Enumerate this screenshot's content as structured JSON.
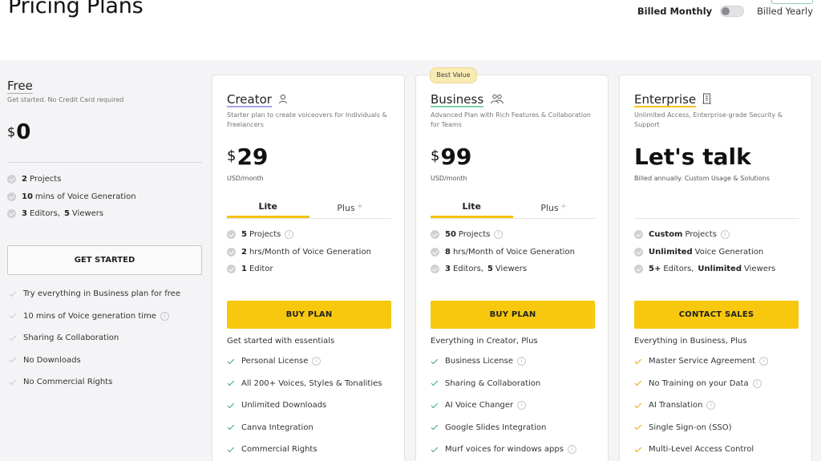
{
  "header": {
    "title": "Pricing Plans",
    "billed_monthly": "Billed Monthly",
    "billed_yearly": "Billed Yearly"
  },
  "free": {
    "name": "Free",
    "desc": "Get started. No Credit Card required",
    "currency": "$",
    "price": "0",
    "core": [
      {
        "bold": "2",
        "text": "Projects"
      },
      {
        "bold": "10",
        "text": "mins of Voice Generation"
      },
      {
        "bold": "3",
        "text": "Editors,",
        "bold2": "5",
        "text2": "Viewers"
      }
    ],
    "button": "GET STARTED",
    "extras": [
      {
        "text": "Try everything in Business plan for free",
        "info": false
      },
      {
        "text": "10 mins of Voice generation time",
        "info": true
      },
      {
        "text": "Sharing & Collaboration",
        "info": false
      },
      {
        "text": "No Downloads",
        "info": false
      },
      {
        "text": "No Commercial Rights",
        "info": false
      }
    ]
  },
  "creator": {
    "name": "Creator",
    "icon": "person-icon",
    "underline_color": "#a7a4f0",
    "desc": "Starter plan to create voiceovers for Individuals & Freelancers",
    "currency": "$",
    "price": "29",
    "unit": "USD/month",
    "tabs": [
      "Lite",
      "Plus"
    ],
    "core": [
      {
        "bold": "5",
        "text": "Projects",
        "info": true
      },
      {
        "bold": "2",
        "text": "hrs/Month of Voice Generation",
        "info": false
      },
      {
        "bold": "1",
        "text": "Editor",
        "info": false
      }
    ],
    "button": "BUY PLAN",
    "everything": "Get started with essentials",
    "extras": [
      {
        "text": "Personal License",
        "info": true
      },
      {
        "text": "All 200+ Voices, Styles & Tonalities",
        "info": false
      },
      {
        "text": "Unlimited Downloads",
        "info": false
      },
      {
        "text": "Canva Integration",
        "info": false
      },
      {
        "text": "Commercial Rights",
        "info": false
      }
    ]
  },
  "business": {
    "badge": "Best Value",
    "name": "Business",
    "icon": "team-icon",
    "underline_color": "#7fd3a6",
    "desc": "Advanced Plan with Rich Features & Collaboration for Teams",
    "currency": "$",
    "price": "99",
    "unit": "USD/month",
    "tabs": [
      "Lite",
      "Plus"
    ],
    "core": [
      {
        "bold": "50",
        "text": "Projects",
        "info": true
      },
      {
        "bold": "8",
        "text": "hrs/Month of Voice Generation",
        "info": false
      },
      {
        "bold": "3",
        "text": "Editors,",
        "bold2": "5",
        "text2": "Viewers",
        "info": false
      }
    ],
    "button": "BUY PLAN",
    "everything": "Everything in Creator, Plus",
    "extras": [
      {
        "text": "Business License",
        "info": true
      },
      {
        "text": "Sharing & Collaboration",
        "info": false
      },
      {
        "text": "AI Voice Changer",
        "info": true
      },
      {
        "text": "Google Slides Integration",
        "info": false
      },
      {
        "text": "Murf voices for windows apps",
        "info": true
      }
    ]
  },
  "enterprise": {
    "name": "Enterprise",
    "icon": "building-icon",
    "underline_color": "#f5c518",
    "desc": "Unlimited Access, Enterprise-grade Security & Support",
    "price": "Let's talk",
    "unit": "Billed annually. Custom Usage & Solutions",
    "core": [
      {
        "bold": "Custom",
        "text": "Projects",
        "info": true
      },
      {
        "bold": "Unlimited",
        "text": "Voice Generation",
        "info": false
      },
      {
        "bold": "5+",
        "text": "Editors,",
        "bold2": "Unlimited",
        "text2": "Viewers",
        "info": false
      }
    ],
    "button": "CONTACT SALES",
    "everything": "Everything in Business, Plus",
    "extras": [
      {
        "text": "Master Service Agreement",
        "info": true
      },
      {
        "text": "No Training on your Data",
        "info": true
      },
      {
        "text": "AI Translation",
        "info": true
      },
      {
        "text": "Single Sign-on (SSO)",
        "info": false
      },
      {
        "text": "Multi-Level Access Control",
        "info": false
      }
    ]
  }
}
